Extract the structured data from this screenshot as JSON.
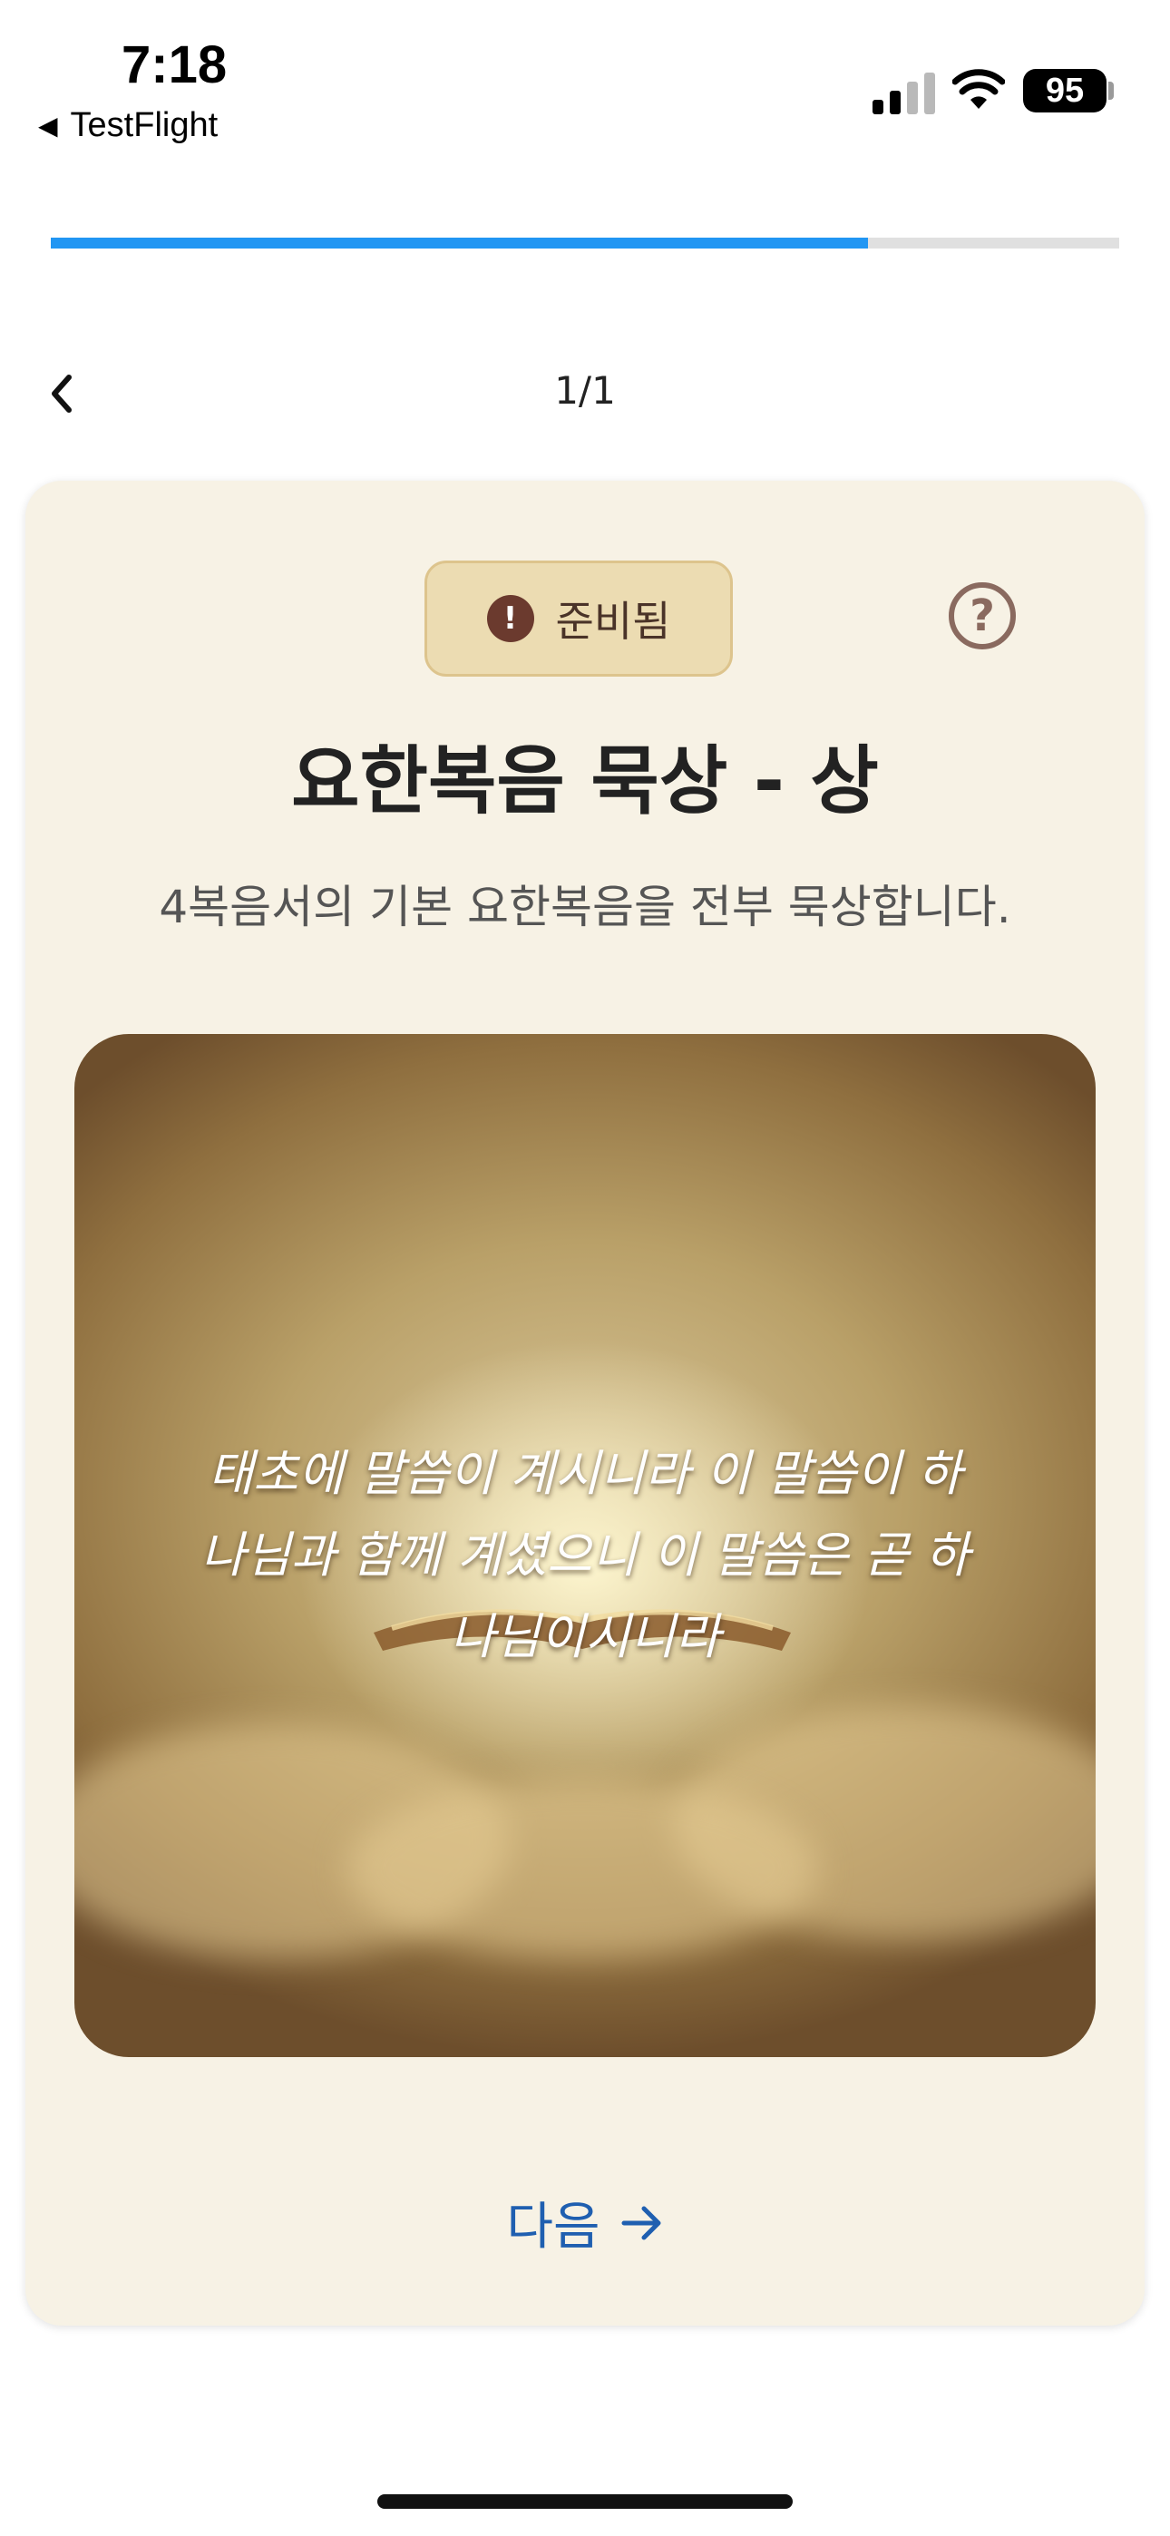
{
  "status_bar": {
    "time": "7:18",
    "back_app": "TestFlight",
    "battery": "95"
  },
  "progress": {
    "fraction": 0.765,
    "color": "#2196f3"
  },
  "nav": {
    "page_counter": "1/1"
  },
  "card": {
    "badge_label": "준비됨",
    "title": "요한복음 묵상 - 상",
    "description": "4복음서의 기본 요한복음을 전부 묵상합니다.",
    "quote_lines": [
      "태초에 말씀이 계시니라 이 말씀이 하",
      "나님과 함께 계셨으니 이 말씀은 곧 하",
      "나님이시니라"
    ],
    "next_label": "다음"
  },
  "colors": {
    "card_bg": "#f7f2e5",
    "badge_bg": "#ecdcb2",
    "accent": "#1f5fb0",
    "title": "#222222"
  }
}
